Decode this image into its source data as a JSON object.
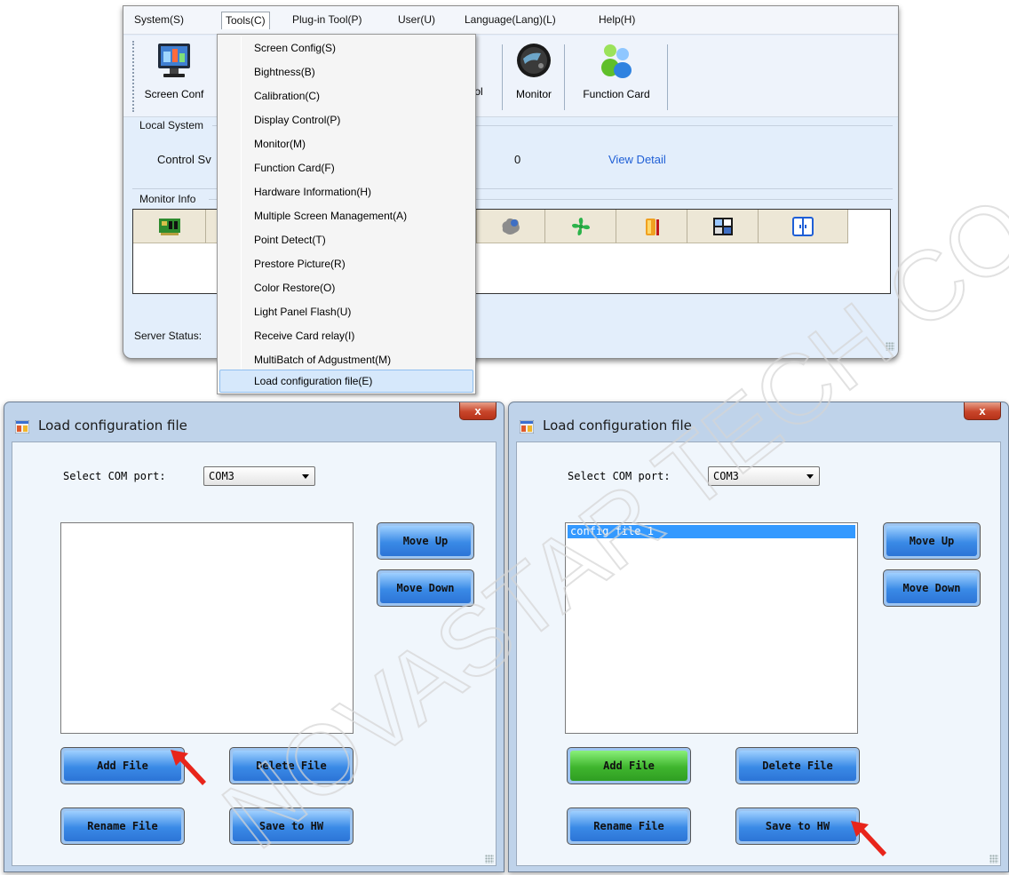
{
  "menubar": {
    "items": [
      {
        "label": "System(S)"
      },
      {
        "label": "Tools(C)"
      },
      {
        "label": "Plug-in Tool(P)"
      },
      {
        "label": "User(U)"
      },
      {
        "label": "Language(Lang)(L)"
      },
      {
        "label": "Help(H)"
      }
    ]
  },
  "toolbar": {
    "screen_config_label": "Screen Conf",
    "display_control_label": "trol",
    "monitor_label": "Monitor",
    "function_card_label": "Function Card"
  },
  "local_system": {
    "title": "Local System",
    "control_label": "Control Sv",
    "count_value": "0",
    "view_detail_link": "View Detail"
  },
  "monitor_info": {
    "title": "Monitor Info"
  },
  "server_status_label": "Server Status:",
  "tools_menu": {
    "items": [
      {
        "label": "Screen Config(S)"
      },
      {
        "label": "Bightness(B)"
      },
      {
        "label": "Calibration(C)"
      },
      {
        "label": "Display Control(P)"
      },
      {
        "label": "Monitor(M)"
      },
      {
        "label": "Function Card(F)"
      },
      {
        "label": "Hardware Information(H)"
      },
      {
        "label": "Multiple Screen Management(A)"
      },
      {
        "label": "Point Detect(T)"
      },
      {
        "label": "Prestore Picture(R)"
      },
      {
        "label": "Color Restore(O)"
      },
      {
        "label": "Light Panel Flash(U)"
      },
      {
        "label": "Receive Card relay(I)"
      },
      {
        "label": "MultiBatch of Adgustment(M)"
      },
      {
        "label": "Load configuration file(E)"
      }
    ],
    "selected_index": 14
  },
  "dialogs": [
    {
      "title": "Load configuration file",
      "close_label": "x",
      "com_label": "Select COM port:",
      "com_value": "COM3",
      "list_items": [],
      "move_up": "Move Up",
      "move_down": "Move Down",
      "add_file": "Add File",
      "delete_file": "Delete File",
      "rename_file": "Rename File",
      "save_to_hw": "Save to HW"
    },
    {
      "title": "Load configuration file",
      "close_label": "x",
      "com_label": "Select COM port:",
      "com_value": "COM3",
      "list_items": [
        "config file 1"
      ],
      "move_up": "Move Up",
      "move_down": "Move Down",
      "add_file": "Add File",
      "delete_file": "Delete File",
      "rename_file": "Rename File",
      "save_to_hw": "Save to HW"
    }
  ],
  "watermark": {
    "text": "NOVASTAR TECH CO., L",
    "color": "#d8d8d8"
  },
  "colors": {
    "accent": "#3399ff",
    "link": "#1f5fd6",
    "pointer_arrow": "#e8251b",
    "add_file_active": "#3fb52e"
  }
}
